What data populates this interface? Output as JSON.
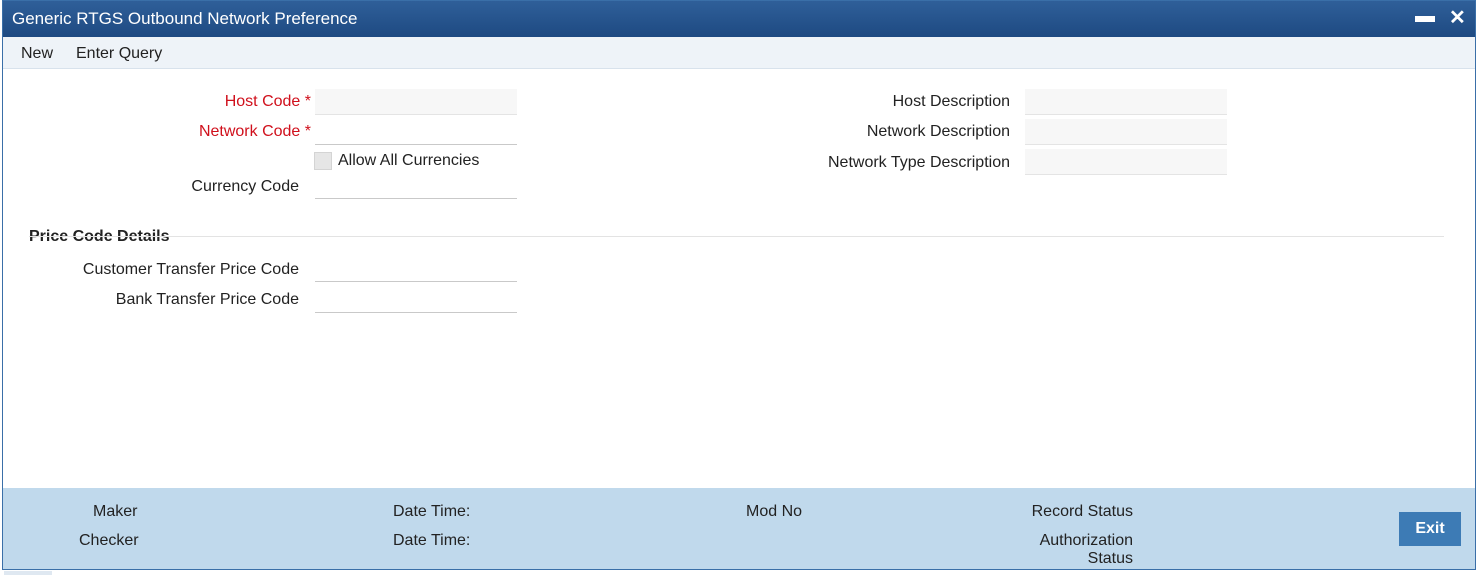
{
  "window": {
    "title": "Generic RTGS Outbound Network Preference",
    "minimize_glyph": "▬",
    "close_glyph": "✕"
  },
  "menu": {
    "new_label": "New",
    "enter_query_label": "Enter Query"
  },
  "form": {
    "host_code_label": "Host Code",
    "network_code_label": "Network Code",
    "required_marker": "*",
    "allow_all_currencies_label": "Allow All Currencies",
    "currency_code_label": "Currency Code",
    "host_description_label": "Host Description",
    "network_description_label": "Network Description",
    "network_type_description_label": "Network Type Description"
  },
  "price_code": {
    "section_title": "Price Code Details",
    "customer_transfer_label": "Customer Transfer Price Code",
    "bank_transfer_label": "Bank Transfer Price Code"
  },
  "footer": {
    "maker_label": "Maker",
    "checker_label": "Checker",
    "date_time_label_1": "Date Time:",
    "date_time_label_2": "Date Time:",
    "mod_no_label": "Mod No",
    "record_status_label": "Record Status",
    "authorization_label": "Authorization",
    "status_label": "Status",
    "exit_label": "Exit"
  },
  "colors": {
    "titlebar": "#1e4a82",
    "required": "#d0101c",
    "footer": "#c0d9ec",
    "exit_button": "#3d7bb5"
  }
}
